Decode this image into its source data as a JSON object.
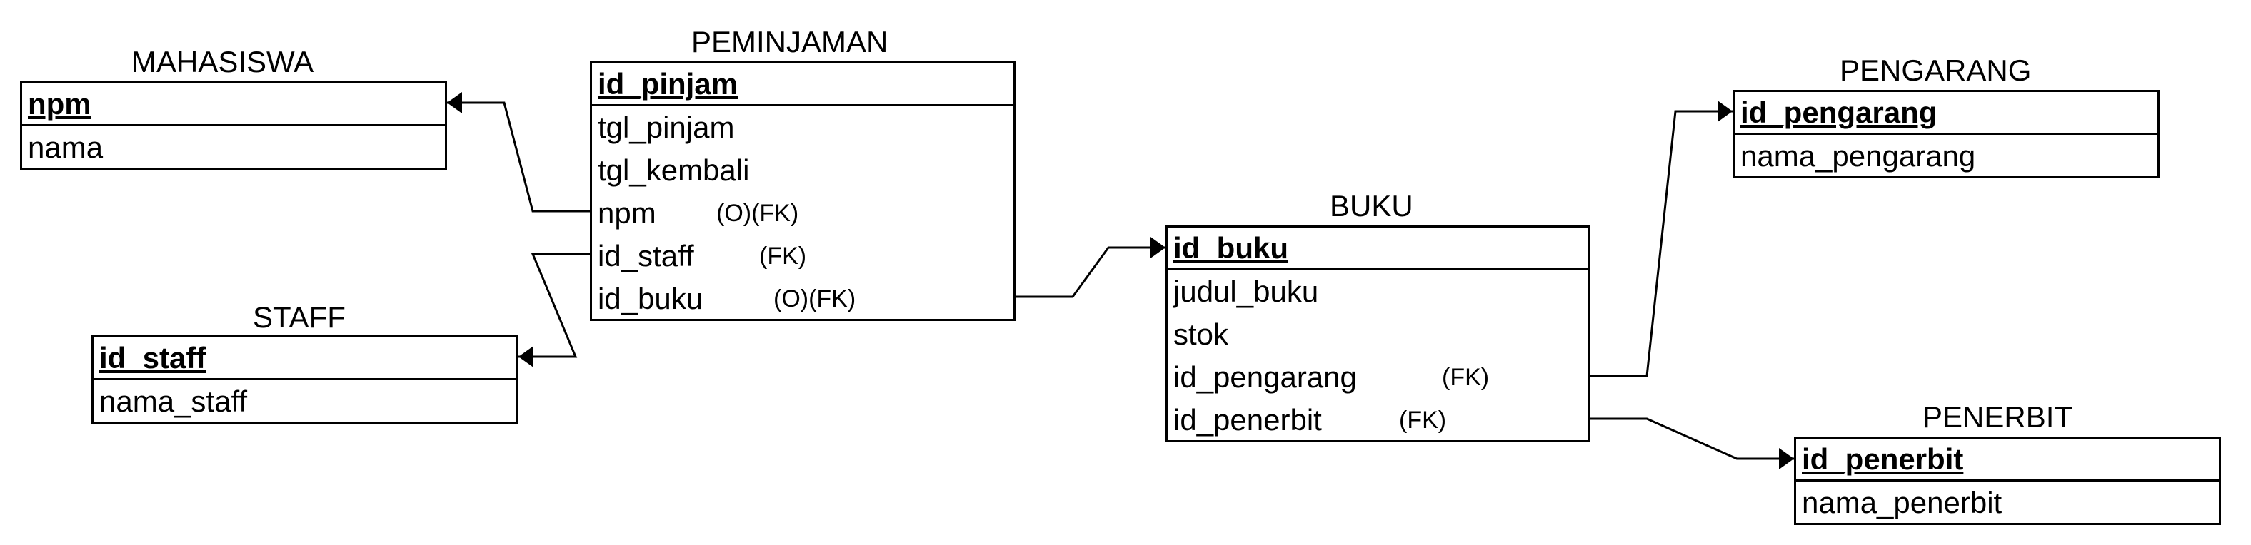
{
  "entities": {
    "mahasiswa": {
      "name": "MAHASISWA",
      "pk": "npm",
      "fields": [
        "nama"
      ]
    },
    "staff": {
      "name": "STAFF",
      "pk": "id_staff",
      "fields": [
        "nama_staff"
      ]
    },
    "peminjaman": {
      "name": "PEMINJAMAN",
      "pk": "id_pinjam",
      "fields": [
        "tgl_pinjam",
        "tgl_kembali",
        "npm",
        "id_staff",
        "id_buku"
      ],
      "notes": {
        "npm": "(O)(FK)",
        "id_staff": "(FK)",
        "id_buku": "(O)(FK)"
      }
    },
    "buku": {
      "name": "BUKU",
      "pk": "id_buku",
      "fields": [
        "judul_buku",
        "stok",
        "id_pengarang",
        "id_penerbit"
      ],
      "notes": {
        "id_pengarang": "(FK)",
        "id_penerbit": "(FK)"
      }
    },
    "pengarang": {
      "name": "PENGARANG",
      "pk": "id_pengarang",
      "fields": [
        "nama_pengarang"
      ]
    },
    "penerbit": {
      "name": "PENERBIT",
      "pk": "id_penerbit",
      "fields": [
        "nama_penerbit"
      ]
    }
  }
}
